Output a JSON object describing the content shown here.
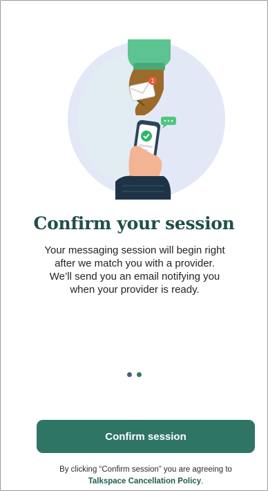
{
  "onboarding": {
    "title": "Confirm your session",
    "description": "Your messaging session will begin right after we match you with a provider. We’ll send you an email notifying you when your provider is ready.",
    "pagination": {
      "total": 2,
      "active_index": 1,
      "colors": {
        "inactive": "#4b5d7a",
        "active": "#2f7566"
      }
    },
    "illustration": {
      "icon": "hand-with-envelope-and-phone",
      "notification_badge": "1",
      "chat_bubble": "...",
      "colors": {
        "circle": "#e3e8f7",
        "sleeve": "#5cc490",
        "glove": "#9c6a2a",
        "phone": "#2c4656",
        "check": "#2fb56b"
      }
    }
  },
  "footer": {
    "confirm_label": "Confirm session",
    "legal_text": "By clicking “Confirm session” you are agreeing to",
    "policy_link": "Talkspace Cancellation Policy",
    "policy_suffix": "."
  },
  "colors": {
    "accent": "#2f7566",
    "title": "#1f4f4a"
  }
}
